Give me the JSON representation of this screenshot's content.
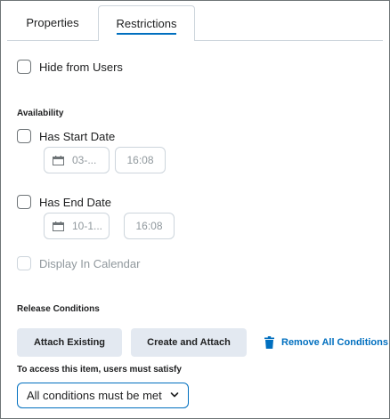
{
  "tabs": {
    "properties": "Properties",
    "restrictions": "Restrictions",
    "active_color": "#006fbf"
  },
  "hide_from_users": {
    "label": "Hide from Users"
  },
  "availability": {
    "heading": "Availability",
    "start": {
      "label": "Has Start Date",
      "date": "03-...",
      "time": "16:08"
    },
    "end": {
      "label": "Has End Date",
      "date": "10-1...",
      "time": "16:08"
    },
    "calendar": {
      "label": "Display In Calendar"
    }
  },
  "release": {
    "heading": "Release Conditions",
    "attach_existing": "Attach Existing",
    "create_and_attach": "Create and Attach",
    "remove_all": "Remove All Conditions",
    "satisfy_label": "To access this item, users must satisfy",
    "satisfy_value": "All conditions must be met"
  },
  "icons": {
    "date": "calendar-icon",
    "remove": "trash-icon",
    "select": "chevron-down-icon"
  }
}
